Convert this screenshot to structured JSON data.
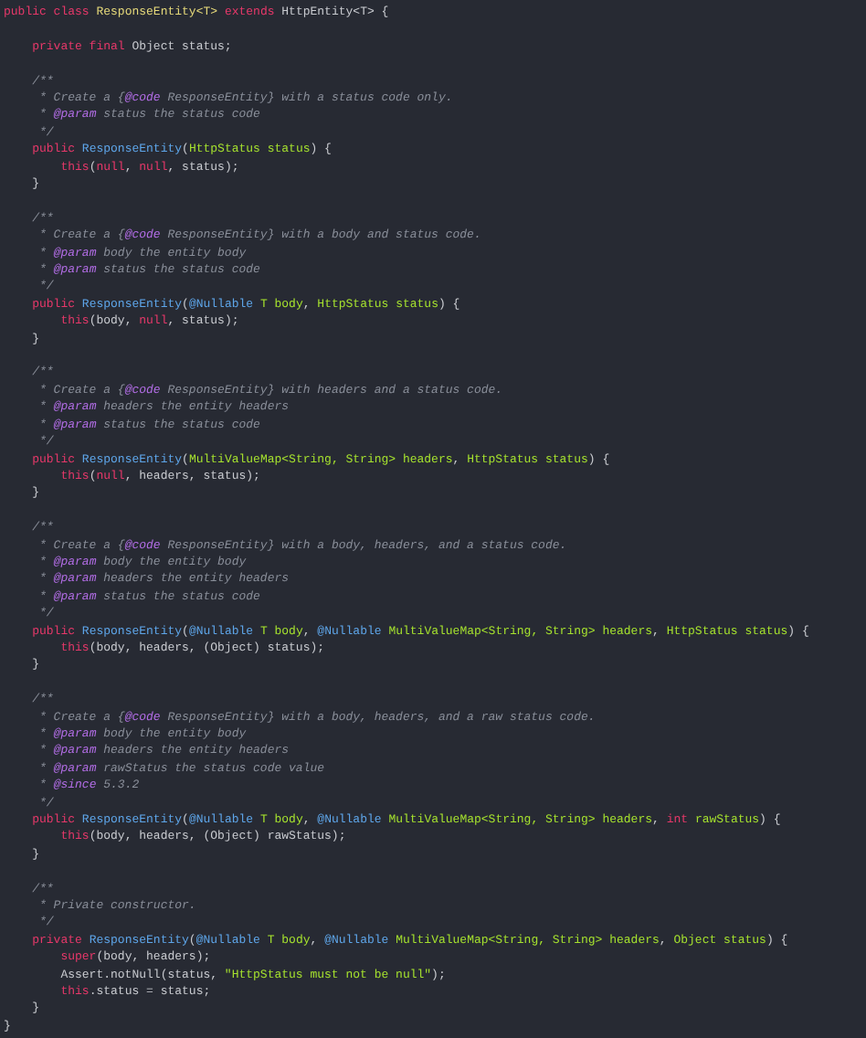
{
  "blocks": [
    {
      "lines": [
        [
          {
            "kind": "keyword",
            "text": "public class "
          },
          {
            "kind": "class",
            "text": "ResponseEntity<T> "
          },
          {
            "kind": "keyword",
            "text": "extends "
          },
          {
            "kind": "plain",
            "text": "HttpEntity<T> {"
          }
        ]
      ]
    },
    {
      "lines": [
        [
          {
            "kind": "keyword",
            "text": "    private final "
          },
          {
            "kind": "plain",
            "text": "Object status;"
          }
        ]
      ]
    },
    {
      "lines": [
        [
          {
            "kind": "comment",
            "text": "    /**"
          }
        ],
        [
          {
            "kind": "comment",
            "text": "     * Create a {"
          },
          {
            "kind": "doctag",
            "text": "@code"
          },
          {
            "kind": "comment",
            "text": " ResponseEntity} with a status code only."
          }
        ],
        [
          {
            "kind": "comment",
            "text": "     * "
          },
          {
            "kind": "doctag",
            "text": "@param"
          },
          {
            "kind": "comment",
            "text": " status the status code"
          }
        ],
        [
          {
            "kind": "comment",
            "text": "     */"
          }
        ],
        [
          {
            "kind": "keyword",
            "text": "    public "
          },
          {
            "kind": "method",
            "text": "ResponseEntity"
          },
          {
            "kind": "plain",
            "text": "("
          },
          {
            "kind": "type",
            "text": "HttpStatus status"
          },
          {
            "kind": "plain",
            "text": ") {"
          }
        ],
        [
          {
            "kind": "keyword",
            "text": "        this"
          },
          {
            "kind": "plain",
            "text": "("
          },
          {
            "kind": "keyword",
            "text": "null"
          },
          {
            "kind": "plain",
            "text": ", "
          },
          {
            "kind": "keyword",
            "text": "null"
          },
          {
            "kind": "plain",
            "text": ", status);"
          }
        ],
        [
          {
            "kind": "plain",
            "text": "    }"
          }
        ]
      ]
    },
    {
      "lines": [
        [
          {
            "kind": "comment",
            "text": "    /**"
          }
        ],
        [
          {
            "kind": "comment",
            "text": "     * Create a {"
          },
          {
            "kind": "doctag",
            "text": "@code"
          },
          {
            "kind": "comment",
            "text": " ResponseEntity} with a body and status code."
          }
        ],
        [
          {
            "kind": "comment",
            "text": "     * "
          },
          {
            "kind": "doctag",
            "text": "@param"
          },
          {
            "kind": "comment",
            "text": " body the entity body"
          }
        ],
        [
          {
            "kind": "comment",
            "text": "     * "
          },
          {
            "kind": "doctag",
            "text": "@param"
          },
          {
            "kind": "comment",
            "text": " status the status code"
          }
        ],
        [
          {
            "kind": "comment",
            "text": "     */"
          }
        ],
        [
          {
            "kind": "keyword",
            "text": "    public "
          },
          {
            "kind": "method",
            "text": "ResponseEntity"
          },
          {
            "kind": "plain",
            "text": "("
          },
          {
            "kind": "annotation",
            "text": "@Nullable "
          },
          {
            "kind": "type",
            "text": "T body"
          },
          {
            "kind": "plain",
            "text": ", "
          },
          {
            "kind": "type",
            "text": "HttpStatus status"
          },
          {
            "kind": "plain",
            "text": ") {"
          }
        ],
        [
          {
            "kind": "keyword",
            "text": "        this"
          },
          {
            "kind": "plain",
            "text": "(body, "
          },
          {
            "kind": "keyword",
            "text": "null"
          },
          {
            "kind": "plain",
            "text": ", status);"
          }
        ],
        [
          {
            "kind": "plain",
            "text": "    }"
          }
        ]
      ]
    },
    {
      "lines": [
        [
          {
            "kind": "comment",
            "text": "    /**"
          }
        ],
        [
          {
            "kind": "comment",
            "text": "     * Create a {"
          },
          {
            "kind": "doctag",
            "text": "@code"
          },
          {
            "kind": "comment",
            "text": " ResponseEntity} with headers and a status code."
          }
        ],
        [
          {
            "kind": "comment",
            "text": "     * "
          },
          {
            "kind": "doctag",
            "text": "@param"
          },
          {
            "kind": "comment",
            "text": " headers the entity headers"
          }
        ],
        [
          {
            "kind": "comment",
            "text": "     * "
          },
          {
            "kind": "doctag",
            "text": "@param"
          },
          {
            "kind": "comment",
            "text": " status the status code"
          }
        ],
        [
          {
            "kind": "comment",
            "text": "     */"
          }
        ],
        [
          {
            "kind": "keyword",
            "text": "    public "
          },
          {
            "kind": "method",
            "text": "ResponseEntity"
          },
          {
            "kind": "plain",
            "text": "("
          },
          {
            "kind": "type",
            "text": "MultiValueMap<String, String> headers"
          },
          {
            "kind": "plain",
            "text": ", "
          },
          {
            "kind": "type",
            "text": "HttpStatus status"
          },
          {
            "kind": "plain",
            "text": ") {"
          }
        ],
        [
          {
            "kind": "keyword",
            "text": "        this"
          },
          {
            "kind": "plain",
            "text": "("
          },
          {
            "kind": "keyword",
            "text": "null"
          },
          {
            "kind": "plain",
            "text": ", headers, status);"
          }
        ],
        [
          {
            "kind": "plain",
            "text": "    }"
          }
        ]
      ]
    },
    {
      "lines": [
        [
          {
            "kind": "comment",
            "text": "    /**"
          }
        ],
        [
          {
            "kind": "comment",
            "text": "     * Create a {"
          },
          {
            "kind": "doctag",
            "text": "@code"
          },
          {
            "kind": "comment",
            "text": " ResponseEntity} with a body, headers, and a status code."
          }
        ],
        [
          {
            "kind": "comment",
            "text": "     * "
          },
          {
            "kind": "doctag",
            "text": "@param"
          },
          {
            "kind": "comment",
            "text": " body the entity body"
          }
        ],
        [
          {
            "kind": "comment",
            "text": "     * "
          },
          {
            "kind": "doctag",
            "text": "@param"
          },
          {
            "kind": "comment",
            "text": " headers the entity headers"
          }
        ],
        [
          {
            "kind": "comment",
            "text": "     * "
          },
          {
            "kind": "doctag",
            "text": "@param"
          },
          {
            "kind": "comment",
            "text": " status the status code"
          }
        ],
        [
          {
            "kind": "comment",
            "text": "     */"
          }
        ],
        [
          {
            "kind": "keyword",
            "text": "    public "
          },
          {
            "kind": "method",
            "text": "ResponseEntity"
          },
          {
            "kind": "plain",
            "text": "("
          },
          {
            "kind": "annotation",
            "text": "@Nullable "
          },
          {
            "kind": "type",
            "text": "T body"
          },
          {
            "kind": "plain",
            "text": ", "
          },
          {
            "kind": "annotation",
            "text": "@Nullable "
          },
          {
            "kind": "type",
            "text": "MultiValueMap<String, String> headers"
          },
          {
            "kind": "plain",
            "text": ", "
          },
          {
            "kind": "type",
            "text": "HttpStatus status"
          },
          {
            "kind": "plain",
            "text": ") {"
          }
        ],
        [
          {
            "kind": "keyword",
            "text": "        this"
          },
          {
            "kind": "plain",
            "text": "(body, headers, (Object) status);"
          }
        ],
        [
          {
            "kind": "plain",
            "text": "    }"
          }
        ]
      ]
    },
    {
      "lines": [
        [
          {
            "kind": "comment",
            "text": "    /**"
          }
        ],
        [
          {
            "kind": "comment",
            "text": "     * Create a {"
          },
          {
            "kind": "doctag",
            "text": "@code"
          },
          {
            "kind": "comment",
            "text": " ResponseEntity} with a body, headers, and a raw status code."
          }
        ],
        [
          {
            "kind": "comment",
            "text": "     * "
          },
          {
            "kind": "doctag",
            "text": "@param"
          },
          {
            "kind": "comment",
            "text": " body the entity body"
          }
        ],
        [
          {
            "kind": "comment",
            "text": "     * "
          },
          {
            "kind": "doctag",
            "text": "@param"
          },
          {
            "kind": "comment",
            "text": " headers the entity headers"
          }
        ],
        [
          {
            "kind": "comment",
            "text": "     * "
          },
          {
            "kind": "doctag",
            "text": "@param"
          },
          {
            "kind": "comment",
            "text": " rawStatus the status code value"
          }
        ],
        [
          {
            "kind": "comment",
            "text": "     * "
          },
          {
            "kind": "doctag",
            "text": "@since"
          },
          {
            "kind": "comment",
            "text": " 5.3.2"
          }
        ],
        [
          {
            "kind": "comment",
            "text": "     */"
          }
        ],
        [
          {
            "kind": "keyword",
            "text": "    public "
          },
          {
            "kind": "method",
            "text": "ResponseEntity"
          },
          {
            "kind": "plain",
            "text": "("
          },
          {
            "kind": "annotation",
            "text": "@Nullable "
          },
          {
            "kind": "type",
            "text": "T body"
          },
          {
            "kind": "plain",
            "text": ", "
          },
          {
            "kind": "annotation",
            "text": "@Nullable "
          },
          {
            "kind": "type",
            "text": "MultiValueMap<String, String> headers"
          },
          {
            "kind": "plain",
            "text": ", "
          },
          {
            "kind": "keyword",
            "text": "int "
          },
          {
            "kind": "type",
            "text": "rawStatus"
          },
          {
            "kind": "plain",
            "text": ") {"
          }
        ],
        [
          {
            "kind": "keyword",
            "text": "        this"
          },
          {
            "kind": "plain",
            "text": "(body, headers, (Object) rawStatus);"
          }
        ],
        [
          {
            "kind": "plain",
            "text": "    }"
          }
        ]
      ]
    },
    {
      "lines": [
        [
          {
            "kind": "comment",
            "text": "    /**"
          }
        ],
        [
          {
            "kind": "comment",
            "text": "     * Private constructor."
          }
        ],
        [
          {
            "kind": "comment",
            "text": "     */"
          }
        ],
        [
          {
            "kind": "keyword",
            "text": "    private "
          },
          {
            "kind": "method",
            "text": "ResponseEntity"
          },
          {
            "kind": "plain",
            "text": "("
          },
          {
            "kind": "annotation",
            "text": "@Nullable "
          },
          {
            "kind": "type",
            "text": "T body"
          },
          {
            "kind": "plain",
            "text": ", "
          },
          {
            "kind": "annotation",
            "text": "@Nullable "
          },
          {
            "kind": "type",
            "text": "MultiValueMap<String, String> headers"
          },
          {
            "kind": "plain",
            "text": ", "
          },
          {
            "kind": "type",
            "text": "Object status"
          },
          {
            "kind": "plain",
            "text": ") {"
          }
        ],
        [
          {
            "kind": "keyword",
            "text": "        super"
          },
          {
            "kind": "plain",
            "text": "(body, headers);"
          }
        ],
        [
          {
            "kind": "plain",
            "text": "        Assert.notNull(status, "
          },
          {
            "kind": "string",
            "text": "\"HttpStatus must not be null\""
          },
          {
            "kind": "plain",
            "text": ");"
          }
        ],
        [
          {
            "kind": "keyword",
            "text": "        this"
          },
          {
            "kind": "plain",
            "text": ".status = status;"
          }
        ],
        [
          {
            "kind": "plain",
            "text": "    }"
          }
        ],
        [
          {
            "kind": "plain",
            "text": "}"
          }
        ]
      ]
    }
  ]
}
